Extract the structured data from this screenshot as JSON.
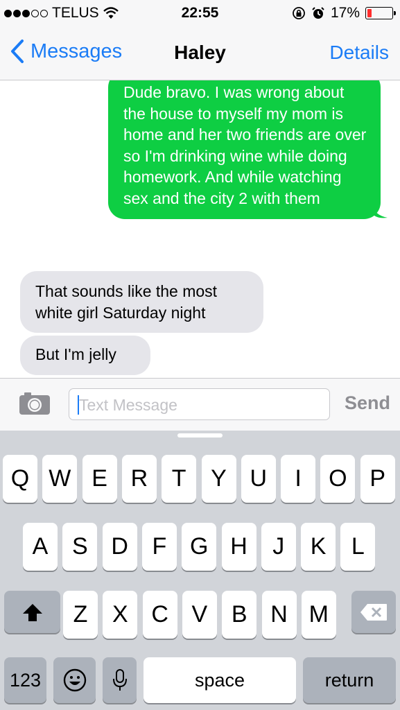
{
  "status_bar": {
    "carrier": "TELUS",
    "time": "22:55",
    "battery": "17%",
    "battery_level": 0.17
  },
  "nav": {
    "back_label": "Messages",
    "title": "Haley",
    "details_label": "Details"
  },
  "messages": [
    {
      "direction": "sent",
      "text": "Dude bravo. I was wrong about the house to myself my mom is home and her two friends are over so I'm drinking wine while doing homework. And while watching sex and the city 2 with them"
    },
    {
      "direction": "received",
      "text": "That sounds like the most white girl Saturday night"
    },
    {
      "direction": "received",
      "text": "But I'm jelly"
    }
  ],
  "input": {
    "placeholder": "Text Message",
    "send_label": "Send"
  },
  "keyboard": {
    "row1": [
      "Q",
      "W",
      "E",
      "R",
      "T",
      "Y",
      "U",
      "I",
      "O",
      "P"
    ],
    "row2": [
      "A",
      "S",
      "D",
      "F",
      "G",
      "H",
      "J",
      "K",
      "L"
    ],
    "row3": [
      "Z",
      "X",
      "C",
      "V",
      "B",
      "N",
      "M"
    ],
    "numbers_label": "123",
    "space_label": "space",
    "return_label": "return"
  },
  "colors": {
    "accent": "#1b7cf6",
    "sent_bubble": "#0ece43",
    "received_bubble": "#e5e5ea",
    "keyboard_bg": "#d1d4d9"
  },
  "icons": [
    "wifi-icon",
    "orientation-lock-icon",
    "alarm-icon",
    "battery-icon",
    "chevron-left-icon",
    "camera-icon",
    "shift-icon",
    "backspace-icon",
    "emoji-icon",
    "microphone-icon"
  ]
}
